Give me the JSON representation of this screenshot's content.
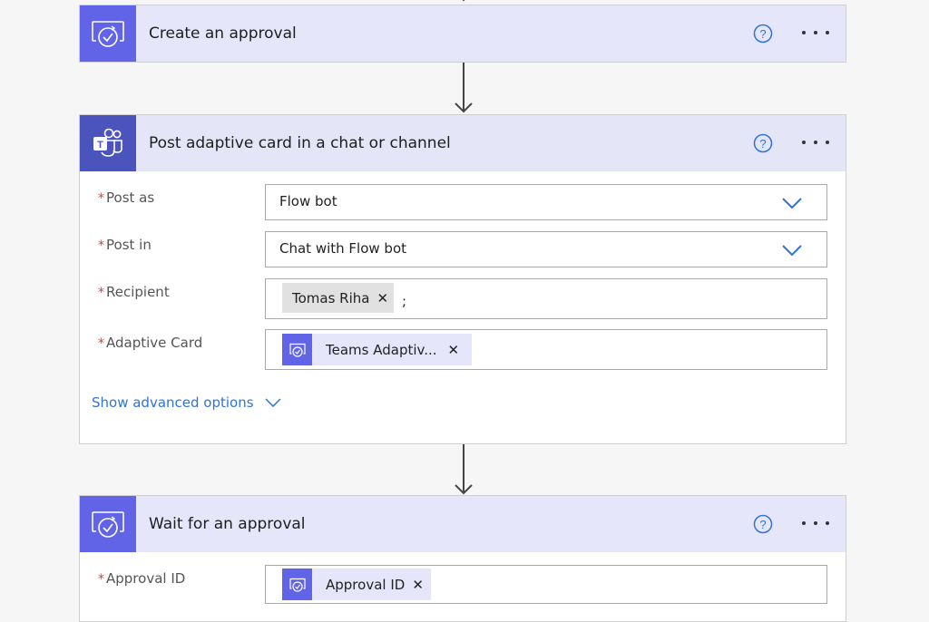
{
  "steps": [
    {
      "title": "Create an approval",
      "icon": "approval-icon"
    },
    {
      "title": "Post adaptive card in a chat or channel",
      "icon": "teams-icon",
      "fields": [
        {
          "label": "Post as",
          "required": true,
          "value": "Flow bot",
          "type": "dropdown"
        },
        {
          "label": "Post in",
          "required": true,
          "value": "Chat with Flow bot",
          "type": "dropdown"
        },
        {
          "label": "Recipient",
          "required": true,
          "chip": "Tomas Riha",
          "suffix": ";",
          "type": "people"
        },
        {
          "label": "Adaptive Card",
          "required": true,
          "token": "Teams Adaptiv...",
          "type": "dynamic"
        }
      ],
      "advanced_options_label": "Show advanced options"
    },
    {
      "title": "Wait for an approval",
      "icon": "approval-icon",
      "fields": [
        {
          "label": "Approval ID",
          "required": true,
          "token": "Approval ID",
          "type": "dynamic"
        }
      ]
    }
  ],
  "required_marker": "*",
  "remove_glyph": "✕",
  "colors": {
    "approval_accent": "#6264e8",
    "teams_accent": "#4b53bc",
    "link_blue": "#2f73d9",
    "required_red": "#e5383b"
  }
}
